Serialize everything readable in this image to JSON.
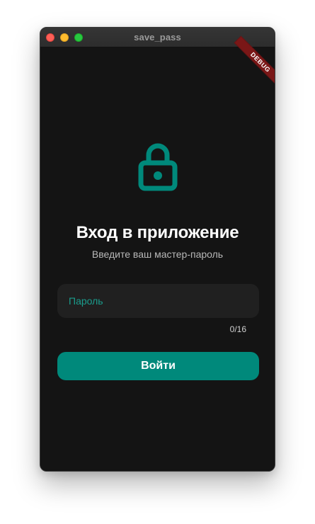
{
  "window": {
    "title": "save_pass"
  },
  "banner": {
    "label": "DEBUG"
  },
  "icons": {
    "lock": "lock-icon"
  },
  "login": {
    "title": "Вход в приложение",
    "subtitle": "Введите ваш мастер-пароль",
    "password_placeholder": "Пароль",
    "password_value": "",
    "counter": "0/16",
    "button_label": "Войти"
  },
  "colors": {
    "background": "#141414",
    "accent": "#00897b",
    "input_background": "#202020",
    "placeholder": "#1a9d8d",
    "debug_banner": "#7a1717"
  }
}
